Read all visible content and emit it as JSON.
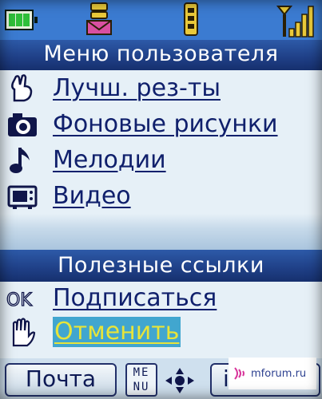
{
  "status_bar": {
    "icons": [
      "battery-icon",
      "message-icon",
      "memory-icon",
      "signal-icon"
    ],
    "battery_color": "#2fbf3a",
    "background": "#3b7bd1"
  },
  "user_menu": {
    "title": "Меню пользователя",
    "items": [
      {
        "label": "Лучш. рез-ты",
        "icon": "trophy-icon"
      },
      {
        "label": "Фоновые рисунки",
        "icon": "camera-icon"
      },
      {
        "label": "Мелодии",
        "icon": "music-note-icon"
      },
      {
        "label": "Видео",
        "icon": "video-icon"
      }
    ]
  },
  "useful_links": {
    "title": "Полезные ссылки",
    "items": [
      {
        "label": "Подписаться",
        "icon": "ok-icon"
      },
      {
        "label": "Отменить",
        "icon": "hand-icon",
        "selected": true
      }
    ]
  },
  "softkeys": {
    "left_label": "Почта",
    "menu_label_top": "ME",
    "menu_label_bottom": "NU",
    "right_label": "i"
  },
  "watermark": {
    "text": "mforum.ru"
  },
  "colors": {
    "title_bar": "#1f3f86",
    "list_background": "#e6f0f7",
    "link_text": "#10206c",
    "selected_background": "#41a6cf",
    "selected_text": "#e7e43a"
  }
}
